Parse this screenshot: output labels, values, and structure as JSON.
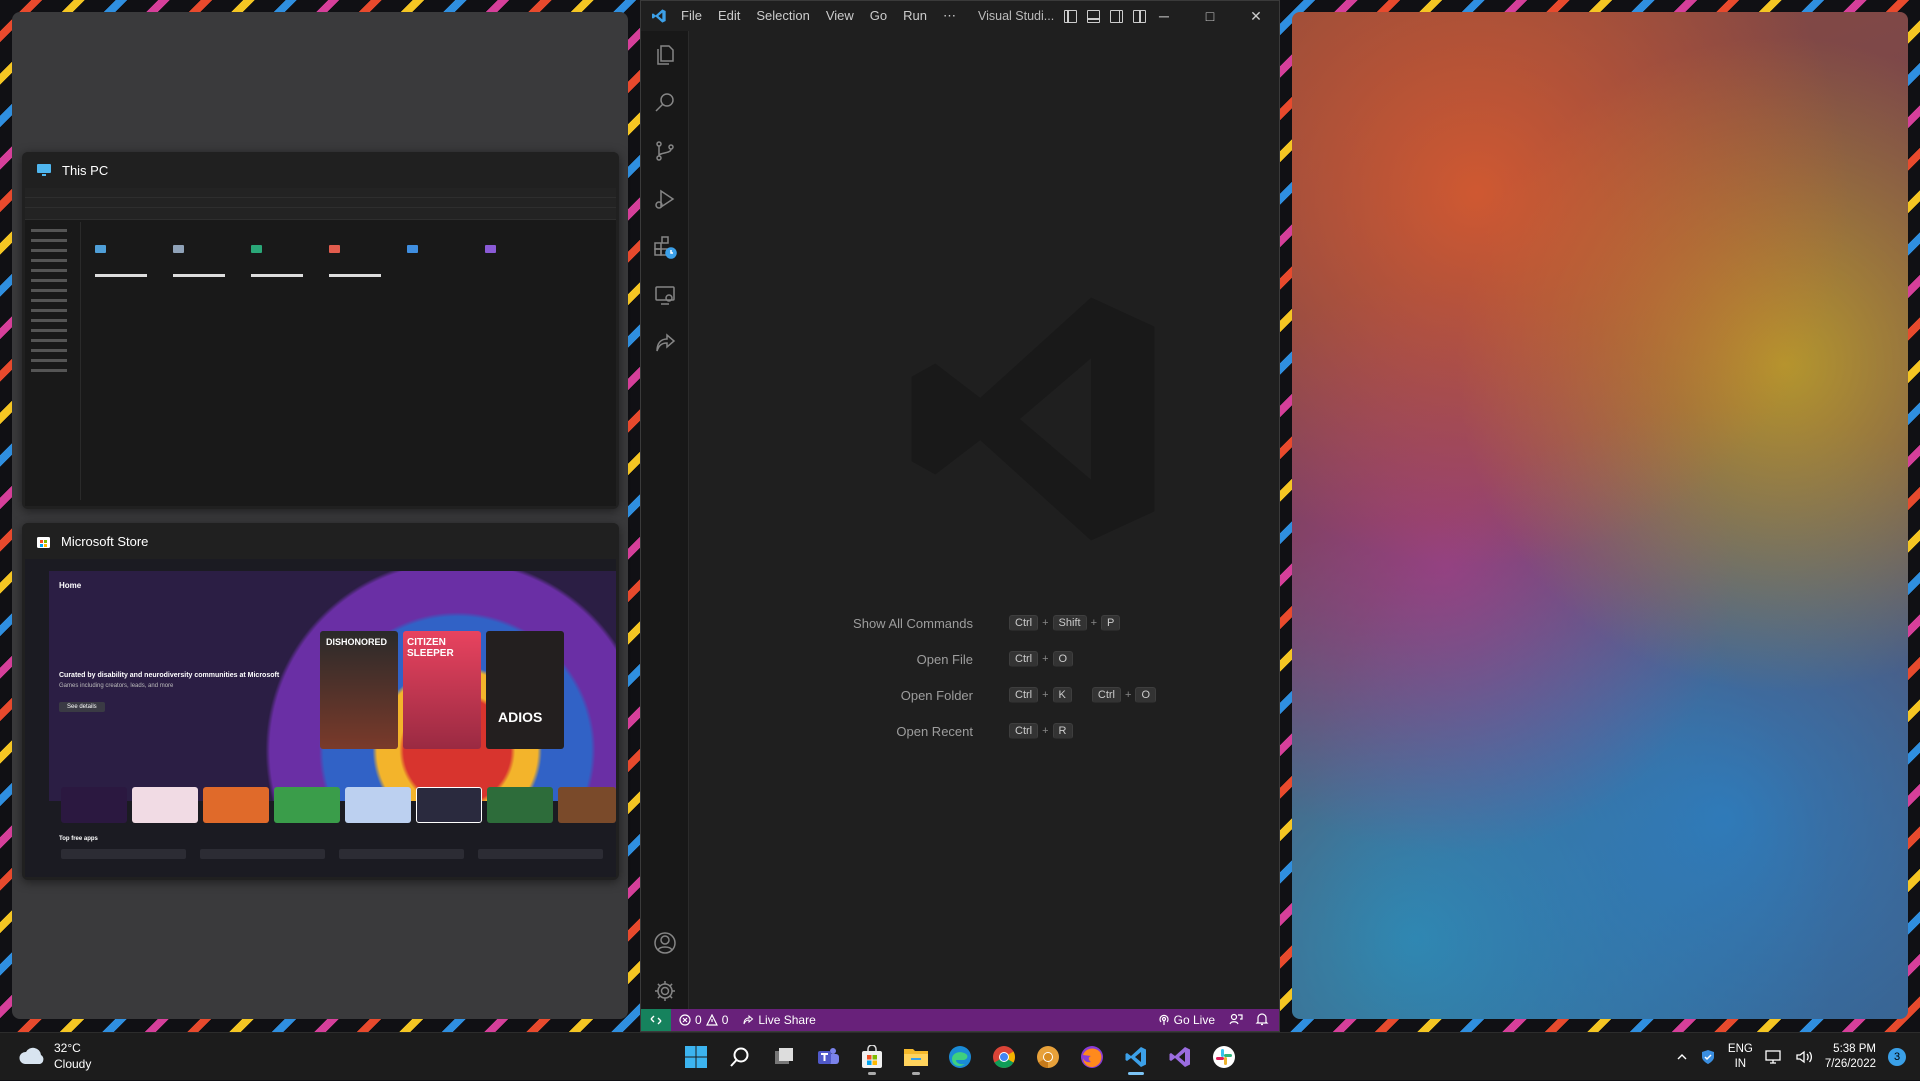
{
  "snap_assist": {
    "windows": [
      {
        "title": "This PC"
      },
      {
        "title": "Microsoft Store"
      }
    ],
    "store_preview": {
      "home_label": "Home",
      "headline": "Curated by disability and neurodiversity communities at Microsoft",
      "subline": "Games including creators, leads, and more",
      "button": "See details",
      "section": "Top free apps",
      "covers": [
        "DISHONORED",
        "CITIZEN SLEEPER",
        "ADIOS"
      ]
    }
  },
  "vscode": {
    "menu": [
      "File",
      "Edit",
      "Selection",
      "View",
      "Go",
      "Run",
      "⋯"
    ],
    "window_title": "Visual Studi...",
    "window_buttons": {
      "minimize": "─",
      "maximize": "□",
      "close": "✕"
    },
    "activity": [
      "files-icon",
      "search-icon",
      "source-control-icon",
      "run-debug-icon",
      "extensions-icon",
      "remote-explorer-icon",
      "live-share-icon",
      "accounts-icon",
      "settings-gear-icon"
    ],
    "shortcuts": [
      {
        "label": "Show All Commands",
        "keys": [
          [
            "Ctrl",
            "Shift",
            "P"
          ]
        ]
      },
      {
        "label": "Open File",
        "keys": [
          [
            "Ctrl",
            "O"
          ]
        ]
      },
      {
        "label": "Open Folder",
        "keys": [
          [
            "Ctrl",
            "K"
          ],
          [
            "Ctrl",
            "O"
          ]
        ]
      },
      {
        "label": "Open Recent",
        "keys": [
          [
            "Ctrl",
            "R"
          ]
        ]
      }
    ],
    "status": {
      "errors": "0",
      "warnings": "0",
      "live_share": "Live Share",
      "go_live": "Go Live"
    },
    "colors": {
      "statusbar": "#68217a",
      "remote": "#16825d"
    }
  },
  "taskbar": {
    "weather": {
      "temp": "32°C",
      "condition": "Cloudy"
    },
    "apps": [
      "windows-start-icon",
      "search-icon",
      "task-view-icon",
      "teams-icon",
      "microsoft-store-icon",
      "file-explorer-icon",
      "edge-icon",
      "chrome-icon",
      "chrome-canary-icon",
      "firefox-icon",
      "vscode-icon",
      "visual-studio-icon",
      "slack-icon"
    ],
    "lang": {
      "line1": "ENG",
      "line2": "IN"
    },
    "time": "5:38 PM",
    "date": "7/26/2022",
    "notifications": "3"
  }
}
